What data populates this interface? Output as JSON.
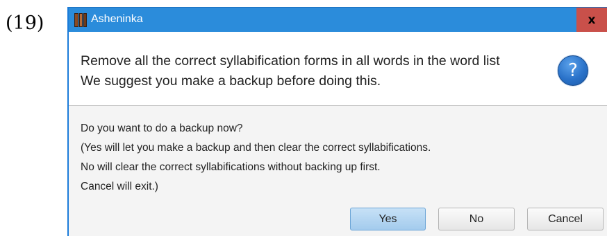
{
  "example_number": "(19)",
  "window": {
    "title": "Asheninka",
    "close_label": "x"
  },
  "header": {
    "line1": "Remove all the correct syllabification forms in all words in the word list",
    "line2": "We suggest you make a backup before doing this.",
    "icon": "question-icon",
    "icon_glyph": "?"
  },
  "content": {
    "line1": "Do you want to do a backup now?",
    "line2": "(Yes will let you make a backup and then clear the correct syllabifications.",
    "line3": "No will clear the correct syllabifications without backing up first.",
    "line4": "Cancel will exit.)"
  },
  "buttons": {
    "yes": "Yes",
    "no": "No",
    "cancel": "Cancel"
  },
  "colors": {
    "titlebar": "#2b8cdb",
    "close_button": "#c9504a",
    "default_button": "#a3cbed"
  }
}
